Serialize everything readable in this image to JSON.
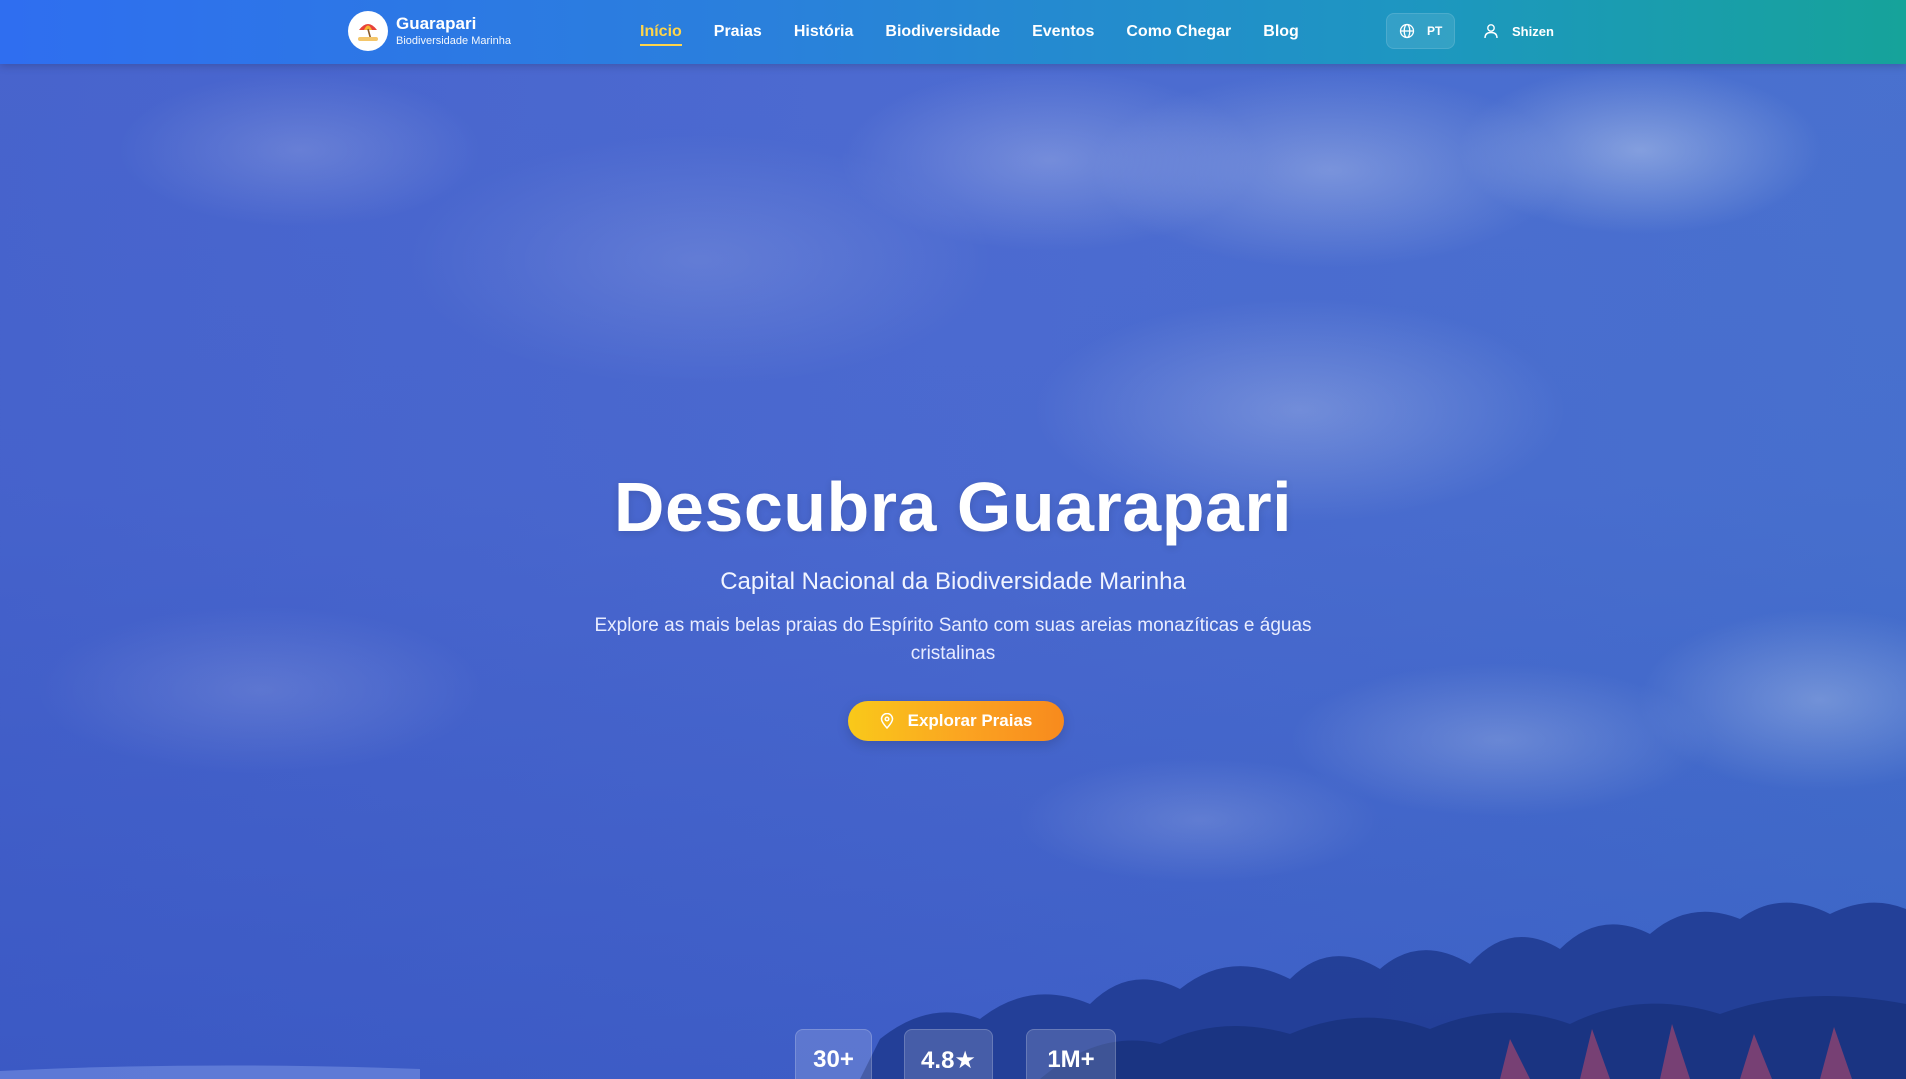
{
  "brand": {
    "title": "Guarapari",
    "subtitle": "Biodiversidade Marinha",
    "logo_icon": "beach-umbrella-icon"
  },
  "nav": {
    "items": [
      {
        "label": "Início",
        "active": true
      },
      {
        "label": "Praias",
        "active": false
      },
      {
        "label": "História",
        "active": false
      },
      {
        "label": "Biodiversidade",
        "active": false
      },
      {
        "label": "Eventos",
        "active": false
      },
      {
        "label": "Como Chegar",
        "active": false
      },
      {
        "label": "Blog",
        "active": false
      }
    ]
  },
  "language": {
    "icon": "globe-icon",
    "label": "PT"
  },
  "user": {
    "icon": "user-icon",
    "name": "Shizen"
  },
  "hero": {
    "title": "Descubra Guarapari",
    "subtitle": "Capital Nacional da Biodiversidade Marinha",
    "description": "Explore as mais belas praias do Espírito Santo com suas areias monazíticas e águas cristalinas",
    "cta": {
      "icon": "map-pin-icon",
      "label": "Explorar Praias"
    }
  },
  "stats": [
    "30+",
    "4.8★",
    "1M+"
  ],
  "colors": {
    "nav_active": "#ffd54a",
    "cta_start": "#f9c91a",
    "cta_end": "#f88a1d",
    "navbar_start": "#2f6ef0",
    "navbar_end": "#16a39a"
  }
}
